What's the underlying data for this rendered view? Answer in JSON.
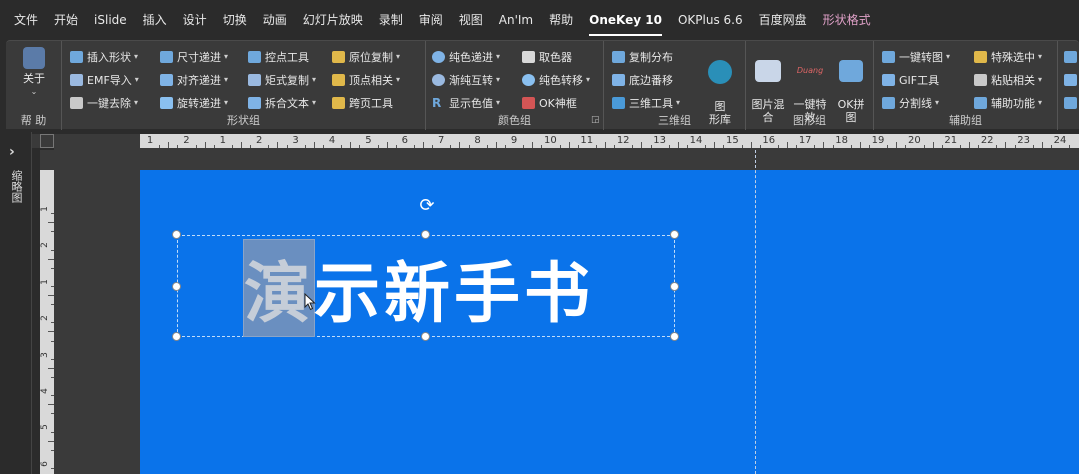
{
  "menubar": {
    "items": [
      "文件",
      "开始",
      "iSlide",
      "插入",
      "设计",
      "切换",
      "动画",
      "幻灯片放映",
      "录制",
      "审阅",
      "视图",
      "An'Im",
      "帮助",
      "OneKey 10",
      "OKPlus 6.6",
      "百度网盘",
      "形状格式"
    ]
  },
  "ribbon": {
    "about": {
      "label": "关于",
      "group": "帮 助"
    },
    "shape_group": {
      "label": "形状组",
      "col1": [
        "插入形状",
        "EMF导入",
        "一键去除"
      ],
      "col2": [
        "尺寸递进",
        "对齐递进",
        "旋转递进"
      ],
      "col3": [
        "控点工具",
        "矩式复制",
        "拆合文本"
      ],
      "col4": [
        "原位复制",
        "顶点相关",
        "跨页工具"
      ]
    },
    "color_group": {
      "label": "颜色组",
      "col1": [
        "纯色递进",
        "渐纯互转",
        "显示色值"
      ],
      "col2": [
        "取色器",
        "纯色转移",
        "OK神框"
      ]
    },
    "three_d_group": {
      "label": "三维组",
      "col1": [
        "复制分布",
        "底边番移",
        "三维工具"
      ],
      "big": "图\n形库"
    },
    "graphic_group": {
      "label": "图形组",
      "big1": "图片混\n合",
      "big2": "一键特\n效",
      "big3": "OK拼\n图",
      "big2_logo": "Duang"
    },
    "aux_group": {
      "label": "辅助组",
      "col1": [
        "一键转图",
        "GIF工具",
        "分割线"
      ],
      "col2": [
        "特殊选中",
        "粘贴相关",
        "辅助功能"
      ]
    }
  },
  "leftpane": {
    "label": "缩略图"
  },
  "rulers": {
    "h_left": [
      "1",
      "2",
      "1",
      "2",
      "3",
      "4",
      "5",
      "6",
      "7",
      "8",
      "9",
      "10",
      "11",
      "12",
      "13",
      "14",
      "15",
      "16",
      "17",
      "18",
      "19",
      "20",
      "21",
      "22",
      "23",
      "24"
    ],
    "v": [
      "1",
      "2",
      "1",
      "2",
      "3",
      "4",
      "5",
      "6"
    ]
  },
  "slide": {
    "text_first": "演",
    "text_rest": "示新手书"
  },
  "colors": {
    "slide_bg": "#0a73ea",
    "ribbon_bg": "#3a3a3a",
    "menu_bg": "#2b2b2b",
    "format_tab": "#e0a1c8"
  }
}
